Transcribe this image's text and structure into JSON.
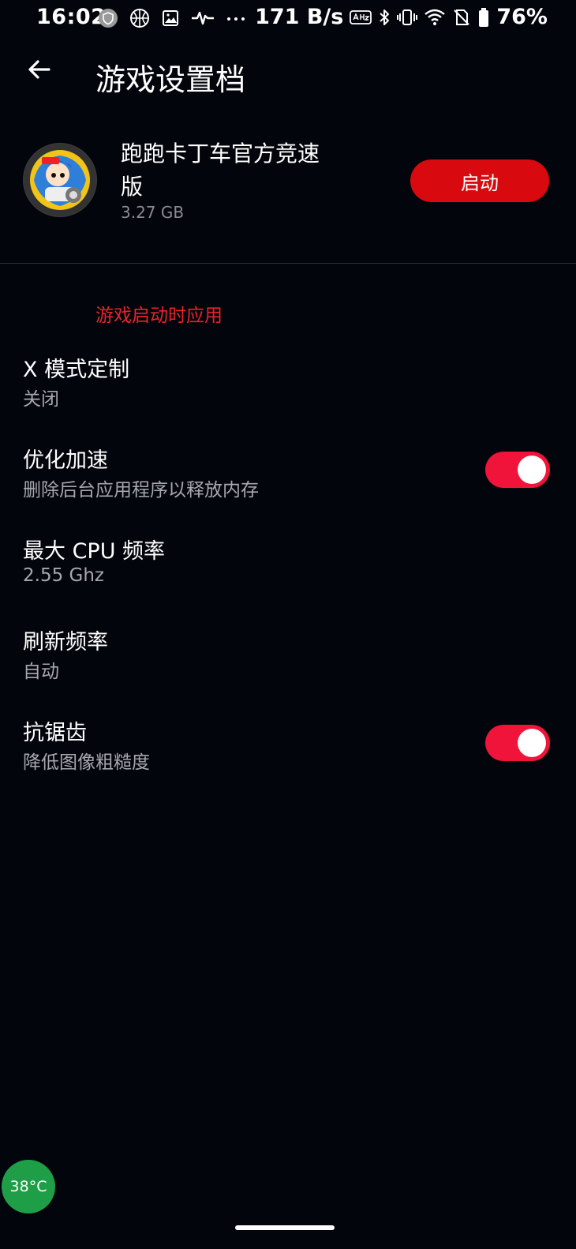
{
  "status_bar": {
    "time": "16:02",
    "left_icons": [
      "shield-badge-icon",
      "basketball-icon",
      "image-icon",
      "activity-wave-icon",
      "more-dots-icon"
    ],
    "speed": "171 B/s",
    "right_icons": [
      "auto-hz-icon",
      "bluetooth-icon",
      "vibrate-icon",
      "wifi-icon",
      "no-sim-icon",
      "battery-icon"
    ],
    "battery": "76%"
  },
  "header": {
    "title": "游戏设置档",
    "back_icon": "back-arrow-icon"
  },
  "app": {
    "name": "跑跑卡丁车官方竞速版",
    "size": "3.27 GB",
    "launch_label": "启动"
  },
  "section": {
    "header": "游戏启动时应用"
  },
  "settings": [
    {
      "title": "X 模式定制",
      "subtitle": "关闭",
      "toggle": null
    },
    {
      "title": "优化加速",
      "subtitle": "删除后台应用程序以释放内存",
      "toggle": true
    },
    {
      "title": "最大 CPU 频率",
      "subtitle": "2.55 Ghz",
      "toggle": null
    },
    {
      "title": "刷新频率",
      "subtitle": "自动",
      "toggle": null
    },
    {
      "title": "抗锯齿",
      "subtitle": "降低图像粗糙度",
      "toggle": true
    }
  ],
  "overlay": {
    "temperature": "38°C"
  },
  "colors": {
    "background": "#03050c",
    "accent_red": "#d80a0f",
    "section_red": "#e8232a",
    "toggle_on": "#f0143a",
    "temp_green": "#1e9e46"
  }
}
